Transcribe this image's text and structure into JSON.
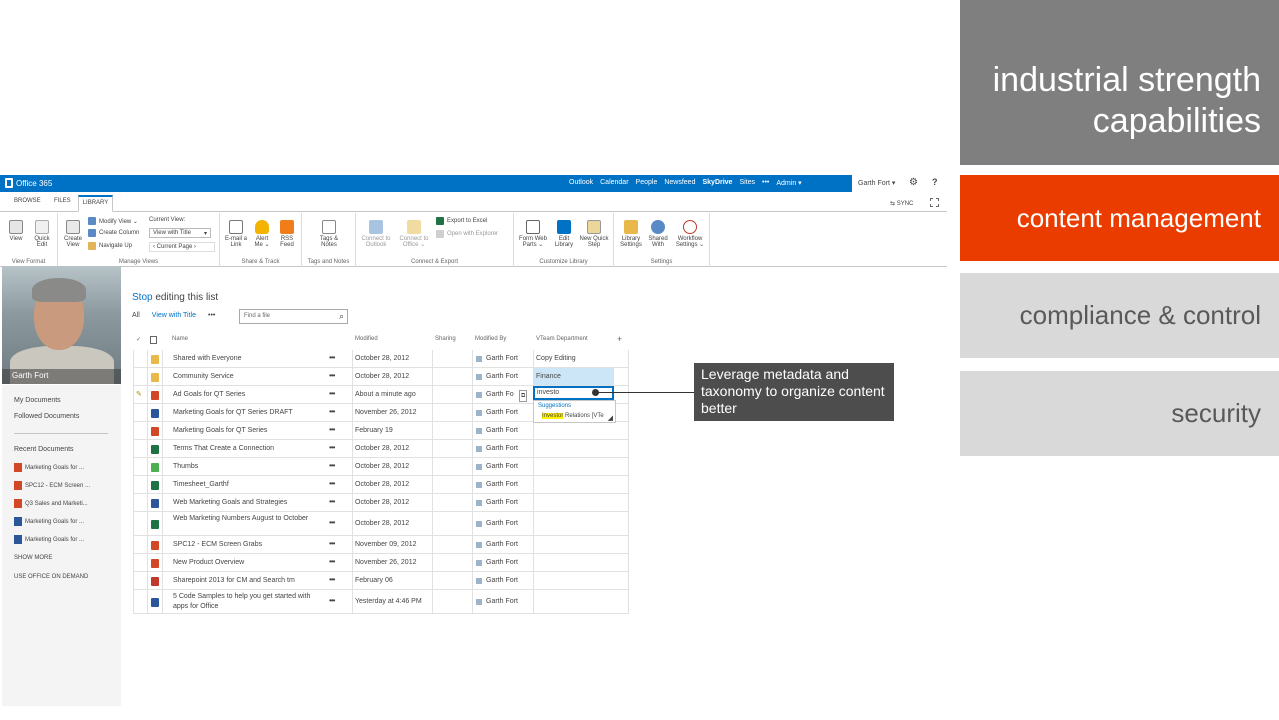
{
  "slide": {
    "industrial_title": "industrial strength capabilities",
    "content_management": "content management",
    "compliance": "compliance & control",
    "security": "security",
    "callout": "Leverage metadata and taxonomy to organize content better",
    "colors": {
      "gray_dark": "#7f7f7f",
      "accent_orange": "#eb3c00",
      "gray_light": "#d9d9d9",
      "callout_bg": "#4d4d4d"
    }
  },
  "suite_bar": {
    "brand": "Office 365",
    "nav": [
      "Outlook",
      "Calendar",
      "People",
      "Newsfeed",
      "SkyDrive",
      "Sites",
      "•••",
      "Admin ▾"
    ],
    "user": "Garth Fort ▾",
    "settings_icon": "gear-icon",
    "help": "?",
    "color": "#0072c6"
  },
  "ribbon_tabs": {
    "browse": "BROWSE",
    "files": "FILES",
    "library": "LIBRARY",
    "sync": "SYNC"
  },
  "ribbon": {
    "view": "View",
    "quick_edit": "Quick Edit",
    "create_view": "Create View",
    "modify_view": "Modify View ⌄",
    "create_column": "Create Column",
    "navigate_up": "Navigate Up",
    "current_view_label": "Current View:",
    "current_view_value": "View with Title",
    "current_page": "Current Page",
    "email_link": "E-mail a Link",
    "alert_me": "Alert Me ⌄",
    "rss_feed": "RSS Feed",
    "tags_notes": "Tags & Notes",
    "connect_outlook": "Connect to Outlook",
    "connect_office": "Connect to Office ⌄",
    "export_excel": "Export to Excel",
    "open_explorer": "Open with Explorer",
    "form_web_parts": "Form Web Parts ⌄",
    "edit_library": "Edit Library",
    "new_quick_step": "New Quick Step",
    "library_settings": "Library Settings",
    "shared_with": "Shared With",
    "workflow_settings": "Workflow Settings ⌄",
    "groups": [
      "View Format",
      "Manage Views",
      "Share & Track",
      "Tags and Notes",
      "Connect & Export",
      "Customize Library",
      "Settings"
    ]
  },
  "profile": {
    "name": "Garth Fort"
  },
  "left_nav": {
    "my_documents": "My Documents",
    "followed": "Followed Documents",
    "recent_heading": "Recent Documents",
    "recent": [
      {
        "label": "Marketing Goals for ...",
        "type": "ppt"
      },
      {
        "label": "SPC12 - ECM Screen ...",
        "type": "ppt"
      },
      {
        "label": "Q3 Sales and Marketi...",
        "type": "ppt"
      },
      {
        "label": "Marketing Goals for ...",
        "type": "doc"
      },
      {
        "label": "Marketing Goals for ...",
        "type": "doc"
      }
    ],
    "show_more": "SHOW MORE",
    "use_office": "USE OFFICE ON DEMAND"
  },
  "list": {
    "title_link": "Stop",
    "title_rest": " editing this list",
    "view_all": "All",
    "view_title": "View with Title",
    "view_more": "•••",
    "search_placeholder": "Find a file",
    "columns": {
      "check": "✓",
      "name": "Name",
      "modified": "Modified",
      "sharing": "Sharing",
      "modified_by": "Modified By",
      "dept": "VTeam Department",
      "add": "+"
    },
    "rows": [
      {
        "name": "Shared with Everyone",
        "modified": "October 28, 2012",
        "by": "Garth Fort",
        "dept": "Copy Editing",
        "type": "folder"
      },
      {
        "name": "Community Service",
        "modified": "October 28, 2012",
        "by": "Garth Fort",
        "dept": "Finance",
        "type": "folder"
      },
      {
        "name": "Ad Goals for QT Series",
        "modified": "About a minute ago",
        "by": "Garth Fo",
        "dept": "investo",
        "type": "ppt"
      },
      {
        "name": "Marketing Goals for QT Series DRAFT",
        "modified": "November 26, 2012",
        "by": "Garth Fort",
        "dept": "",
        "type": "doc"
      },
      {
        "name": "Marketing Goals for QT Series",
        "modified": "February 19",
        "by": "Garth Fort",
        "dept": "",
        "type": "ppt"
      },
      {
        "name": "Terms That Create a Connection",
        "modified": "October 28, 2012",
        "by": "Garth Fort",
        "dept": "",
        "type": "xls"
      },
      {
        "name": "Thumbs",
        "modified": "October 28, 2012",
        "by": "Garth Fort",
        "dept": "",
        "type": "img"
      },
      {
        "name": "Timesheet_Garthf",
        "modified": "October 28, 2012",
        "by": "Garth Fort",
        "dept": "",
        "type": "xls"
      },
      {
        "name": "Web Marketing Goals and Strategies",
        "modified": "October 28, 2012",
        "by": "Garth Fort",
        "dept": "",
        "type": "doc"
      },
      {
        "name": "Web Marketing Numbers August to October",
        "modified": "October 28, 2012",
        "by": "Garth Fort",
        "dept": "",
        "type": "xls"
      },
      {
        "name": "SPC12 - ECM Screen Grabs",
        "modified": "November 09, 2012",
        "by": "Garth Fort",
        "dept": "",
        "type": "ppt"
      },
      {
        "name": "New Product Overview",
        "modified": "November 26, 2012",
        "by": "Garth Fort",
        "dept": "",
        "type": "ppt"
      },
      {
        "name": "Sharepoint 2013 for CM and Search tm",
        "modified": "February 06",
        "by": "Garth Fort",
        "dept": "",
        "type": "pdf"
      },
      {
        "name": "5 Code Samples to help you get started with apps for Office",
        "modified": "Yesterday at 4:46 PM",
        "by": "Garth Fort",
        "dept": "",
        "type": "doc"
      }
    ],
    "suggestions_label": "Suggestions",
    "suggestion_highlight": "Investor",
    "suggestion_rest": " Relations [VTe"
  }
}
